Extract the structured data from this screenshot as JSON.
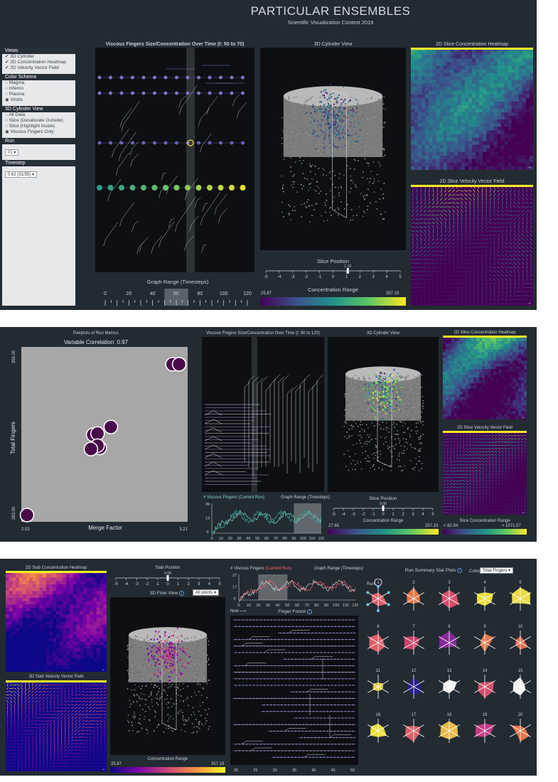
{
  "header": {
    "title": "PARTICULAR ENSEMBLES",
    "subtitle": "Scientific Visualization Contest 2016"
  },
  "panel1": {
    "views_heading": "Views",
    "views": [
      "✔ 3D Cylinder",
      "✔ 2D Concentration Heatmap",
      "✔ 2D Velocity Vector Field"
    ],
    "color_heading": "Color Scheme",
    "colors": [
      "○ Magma",
      "○ Inferno",
      "○ Plasma",
      "◉ Viridis"
    ],
    "cyl_heading": "3D Cylinder View",
    "cyl_options": [
      "○ All Data",
      "○ Slice (Desaturate Outside)",
      "○ Slice (Highlight Inside)",
      "◉ Viscous Fingers Only"
    ],
    "run_heading": "Run",
    "run_value": "01 ▾",
    "timestep_heading": "Timestep",
    "timestep_value": "0.62 (31/35) ▾",
    "graph_title": "Viscous Fingers Size/Concentration Over Time (t: 50 to 70)",
    "cyl_title": "3D Cylinder View",
    "heatmap_title": "2D Slice Concentration Heatmap",
    "vector_title": "2D Slice Velocity Vector Field",
    "graph_range_title": "Graph Range (Timesteps)",
    "graph_range_ticks": [
      "0",
      "20",
      "40",
      "60",
      "80",
      "100",
      "120"
    ],
    "slice_title": "Slice Position",
    "slice_value": "1.13",
    "slice_ticks": [
      "-5",
      "-4",
      "-3",
      "-2",
      "-1",
      "0",
      "1",
      "2",
      "3",
      "4",
      "5"
    ],
    "conc_title": "Concentration Range",
    "conc_min": "25.87",
    "conc_max": "357.19",
    "arrow": "→"
  },
  "panel2": {
    "scatter_title": "Pairplots of Run Metrics",
    "correlation": "Variable Correlation: 0.97",
    "graph_title": "Viscous Fingers Size/Concentration Over Time (t: 90 to 120)",
    "cyl_title": "3D Cylinder View",
    "heatmap_title": "2D Slice Concentration Heatmap",
    "vector_title": "2D Slice Velocity Vector Field",
    "fingers_label": "# Viscous Fingers (Current Run)",
    "graph_range_title": "Graph Range (Timesteps)",
    "slice_title": "Slice Position",
    "slice_value": "0.00",
    "slice_ticks": [
      "-5",
      "-4",
      "-3",
      "-2",
      "-1",
      "0",
      "1",
      "2",
      "3",
      "4",
      "5"
    ],
    "conc_title": "Concentration Range",
    "conc_min": "27.65",
    "conc_max": "257.19",
    "slice_conc_title": "Slice Concentration Range",
    "slice_conc_min": "< 82.94",
    "slice_conc_max": "> 1071.57",
    "fingers_yticks": [
      "26",
      "13",
      "0"
    ],
    "fingers_xticks": [
      "0",
      "10",
      "20",
      "30",
      "40",
      "50",
      "60",
      "70",
      "80",
      "90",
      "100",
      "110",
      "120"
    ],
    "arrow": "→"
  },
  "panel3": {
    "slab_heatmap_title": "2D Slab Concentration Heatmap",
    "slab_vector_title": "2D Slab Velocity Vector Field",
    "slab_position_title": "Slab Position",
    "slab_value": "0.00",
    "slab_ticks": [
      "-5",
      "-4",
      "-3",
      "-2",
      "-1",
      "0",
      "1",
      "2",
      "3",
      "4",
      "5"
    ],
    "flow_title": "3D Flow View",
    "flow_info": "i",
    "points_select": "All points ▾",
    "fingers_prefix": "# Viscous Fingers",
    "fingers_current": "(Current Run)",
    "graph_range_title": "Graph Range (Timesteps)",
    "fingers_yticks": [
      "27",
      "17",
      "0"
    ],
    "fingers_xticks": [
      "0",
      "10",
      "20",
      "30",
      "40",
      "50",
      "60",
      "70",
      "80",
      "90",
      "100",
      "110",
      "120"
    ],
    "now_label": "Now ⟶",
    "forest_title": "Finger Forest",
    "forest_info": "i",
    "forest_xticks": [
      "20",
      "25",
      "30",
      "35",
      "40",
      "45",
      "50"
    ],
    "conc_title": "Concentration Range",
    "conc_min": "25.87",
    "conc_max": "357.19",
    "star_title": "Run Summary Star Plots",
    "star_info": "i",
    "color_label": "Color",
    "color_select": "Total Fingers ▾",
    "run_label": "Run:",
    "arrow": "→",
    "stars": [
      {
        "label": "1",
        "color": "#e8616a"
      },
      {
        "label": "2",
        "color": "#f07a4a"
      },
      {
        "label": "3",
        "color": "#e04f6e"
      },
      {
        "label": "4",
        "color": "#f4e83a"
      },
      {
        "label": "5",
        "color": "#f6e54a"
      },
      {
        "label": "6",
        "color": "#e8616a"
      },
      {
        "label": "7",
        "color": "#d9456e"
      },
      {
        "label": "8",
        "color": "#8c2aa0"
      },
      {
        "label": "9",
        "color": "#f07a4a"
      },
      {
        "label": "10",
        "color": "#ef6f4c"
      },
      {
        "label": "11",
        "color": "#f4d53a"
      },
      {
        "label": "12",
        "color": "#2a1f8f"
      },
      {
        "label": "13",
        "color": "#ffffff"
      },
      {
        "label": "14",
        "color": "#e04f6e"
      },
      {
        "label": "15",
        "color": "#ffffff"
      },
      {
        "label": "16",
        "color": "#f4e83a"
      },
      {
        "label": "17",
        "color": "#e8616a"
      },
      {
        "label": "18",
        "color": "#f3c24a"
      },
      {
        "label": "19",
        "color": "#c93d8a"
      },
      {
        "label": "20",
        "color": "#f07a4a"
      }
    ]
  },
  "chart_data": [
    {
      "type": "scatter",
      "title": "Pairplots of Run Metrics",
      "subtitle": "Variable Correlation: 0.97",
      "xlabel": "Merge Factor",
      "ylabel": "Total Fingers",
      "xlim": [
        2.52,
        3.21
      ],
      "ylim": [
        283.0,
        356.0
      ],
      "x_tick_labels": [
        "2.52",
        "3.21"
      ],
      "y_tick_labels": [
        "283.00",
        "356.00"
      ],
      "x": [
        2.52,
        2.82,
        2.84,
        2.85,
        2.84,
        2.9,
        3.18,
        3.21,
        2.81
      ],
      "y": [
        283.5,
        320.0,
        320.5,
        314.0,
        315.0,
        323.5,
        352.0,
        352.0,
        313.5
      ],
      "marker_color": "#4a0a4a"
    }
  ]
}
